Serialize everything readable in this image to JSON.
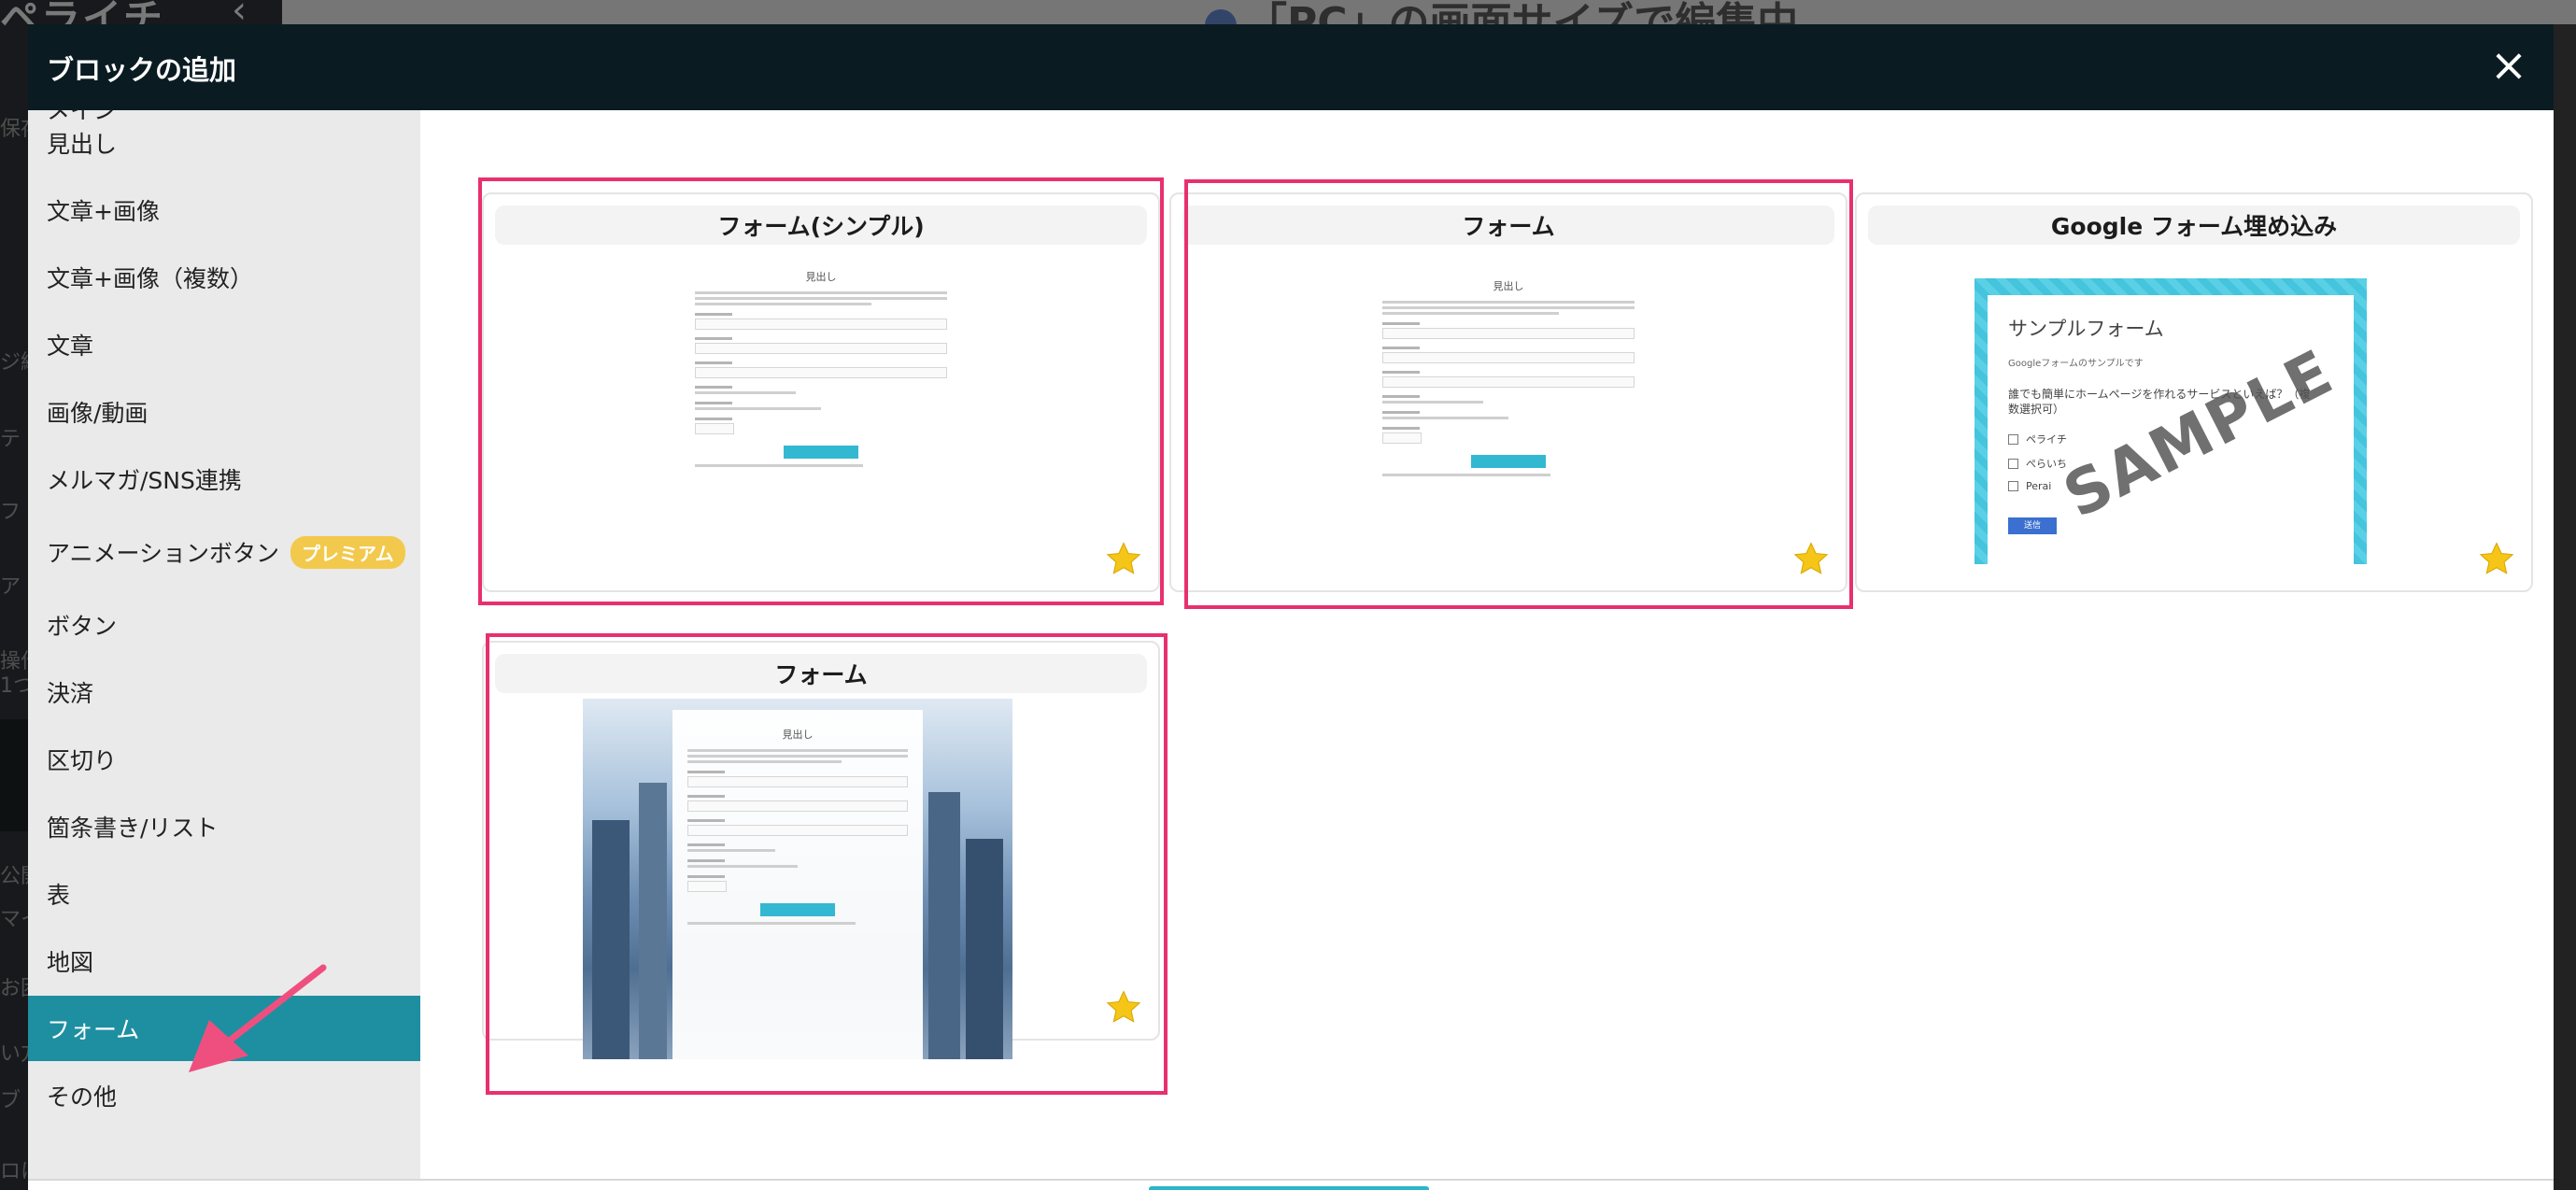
{
  "background": {
    "brand": "ペライチ",
    "heading": "「PC」の画面サイズで編集中",
    "fragments": [
      "保存",
      "ジ編",
      "テ",
      "フ",
      "ア",
      "操作",
      "1つ",
      "公開",
      "マイ",
      "お困",
      "い方",
      "ブ",
      "ロに"
    ]
  },
  "modal": {
    "title": "ブロックの追加",
    "close_label": "×"
  },
  "categories": {
    "cut_off_label": "メイン",
    "items": [
      {
        "label": "見出し"
      },
      {
        "label": "文章+画像"
      },
      {
        "label": "文章+画像（複数）"
      },
      {
        "label": "文章"
      },
      {
        "label": "画像/動画"
      },
      {
        "label": "メルマガ/SNS連携"
      },
      {
        "label": "アニメーションボタン",
        "badge": "プレミアム"
      },
      {
        "label": "ボタン"
      },
      {
        "label": "決済"
      },
      {
        "label": "区切り"
      },
      {
        "label": "箇条書き/リスト"
      },
      {
        "label": "表"
      },
      {
        "label": "地図"
      },
      {
        "label": "フォーム",
        "active": true
      },
      {
        "label": "その他"
      }
    ]
  },
  "cards": [
    {
      "title": "フォーム(シンプル)",
      "thumb_heading": "見出し",
      "highlighted": true,
      "favorite": true
    },
    {
      "title": "フォーム",
      "thumb_heading": "見出し",
      "highlighted": true,
      "favorite": true
    },
    {
      "title": "Google フォーム埋め込み",
      "highlighted": false,
      "favorite": true,
      "thumb": {
        "form_title": "サンプルフォーム",
        "subtitle": "Googleフォームのサンプルです",
        "question": "誰でも簡単にホームページを作れるサービスといえば？（複数選択可）",
        "options": [
          "ペライチ",
          "ぺらいち",
          "Perai"
        ],
        "submit": "送信",
        "watermark": "SAMPLE"
      }
    },
    {
      "title": "フォーム",
      "thumb_heading": "見出し",
      "highlighted": true,
      "favorite": true
    }
  ],
  "colors": {
    "header_bg": "#0a1c22",
    "active_category": "#1e8fa1",
    "highlight": "#e8306e",
    "star": "#f5c518",
    "premium": "#f2c94c"
  },
  "icons": [
    "close-icon",
    "star-icon",
    "pointer-arrow-icon"
  ]
}
